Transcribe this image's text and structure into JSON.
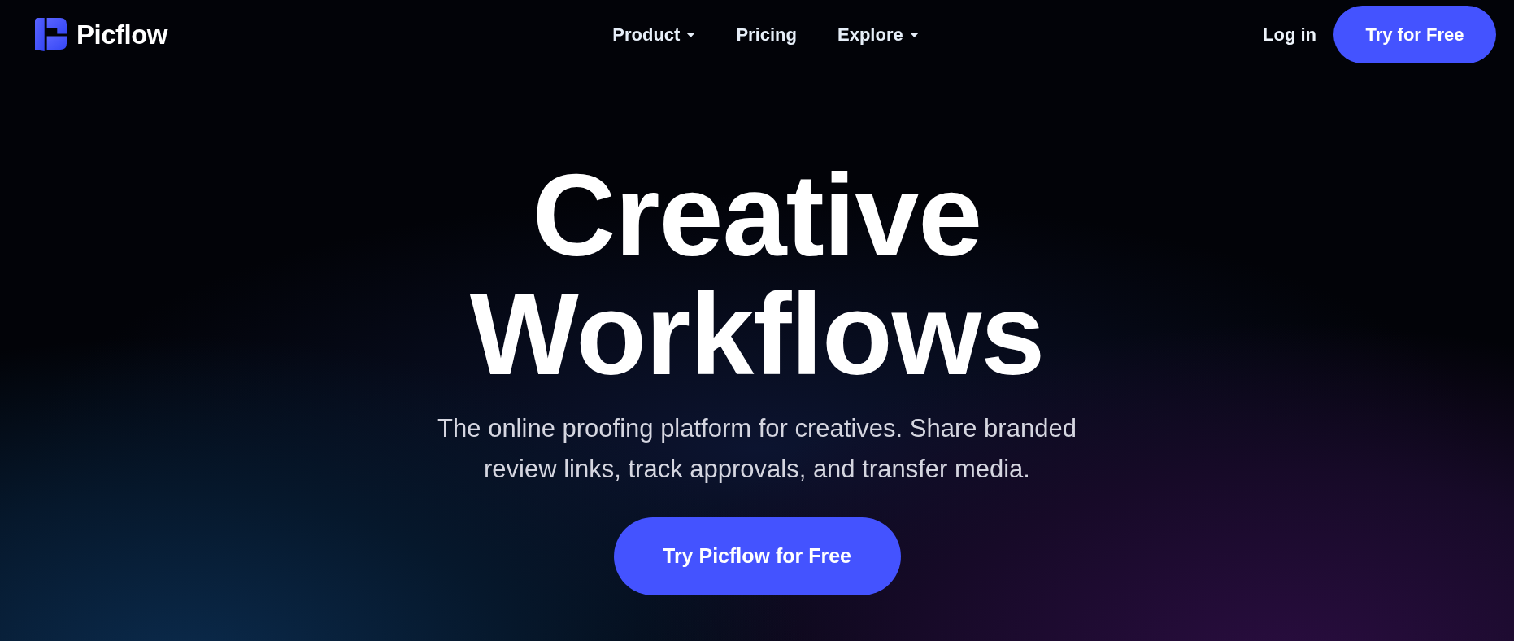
{
  "header": {
    "logo": {
      "text": "Picflow"
    },
    "nav": [
      {
        "label": "Product",
        "has_dropdown": true
      },
      {
        "label": "Pricing",
        "has_dropdown": false
      },
      {
        "label": "Explore",
        "has_dropdown": true
      }
    ],
    "login": "Log in",
    "cta": "Try for Free"
  },
  "hero": {
    "title": "Creative Workflows",
    "subtitle": "The online proofing platform for creatives. Share branded review links, track approvals, and transfer media.",
    "cta": "Try Picflow for Free"
  }
}
